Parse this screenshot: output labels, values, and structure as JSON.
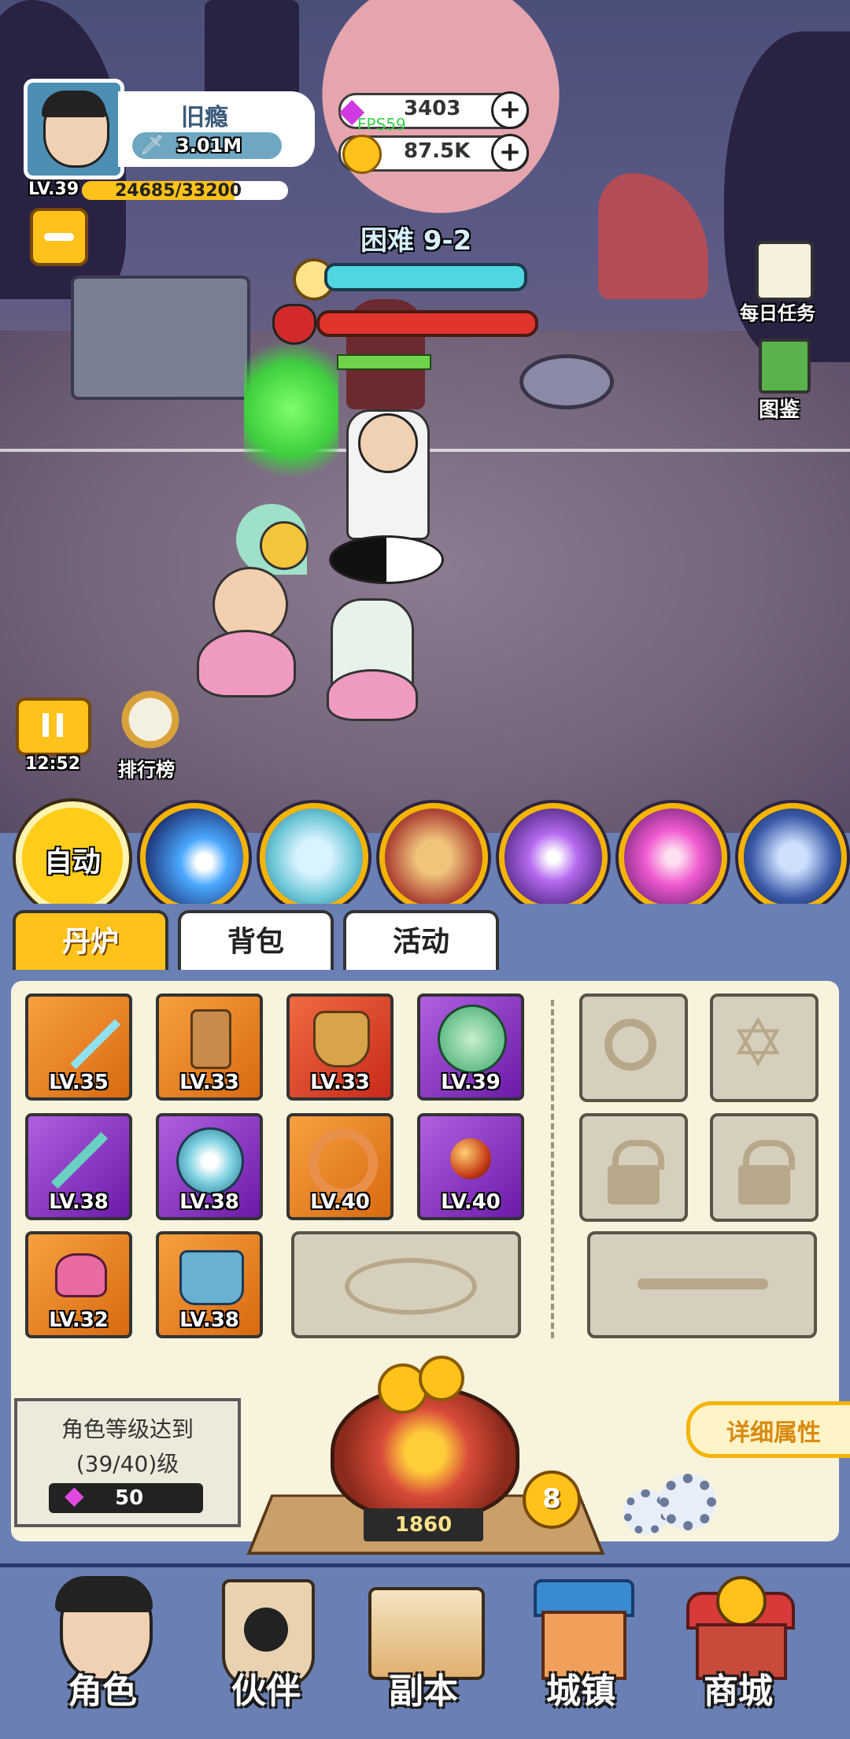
{
  "player": {
    "name": "旧瘾",
    "power": "3.01M",
    "level": "LV.39",
    "exp": "24685/33200"
  },
  "currency": {
    "gems": "3403",
    "coins": "87.5K",
    "fps": "FPS59"
  },
  "stage": {
    "label": "困难 9-2"
  },
  "side_menu": {
    "daily_tasks": "每日任务",
    "codex": "图鉴"
  },
  "battle_controls": {
    "timer": "12:52",
    "ranking": "排行榜"
  },
  "skills": {
    "auto": "自动",
    "list": [
      "comet-skill-icon",
      "ice-qilin-skill-icon",
      "beast-skill-icon",
      "purple-vortex-skill-icon",
      "pink-spiral-skill-icon",
      "thunder-card-skill-icon"
    ]
  },
  "tabs": [
    "丹炉",
    "背包",
    "活动"
  ],
  "equipment": [
    {
      "name": "sword-icon",
      "level": "LV.35",
      "rarity": "orange"
    },
    {
      "name": "scroll-icon",
      "level": "LV.33",
      "rarity": "orange"
    },
    {
      "name": "armor-icon",
      "level": "LV.33",
      "rarity": "red"
    },
    {
      "name": "dragon-orb-icon",
      "level": "LV.39",
      "rarity": "purple"
    },
    {
      "name": "jade-sword-icon",
      "level": "LV.38",
      "rarity": "purple"
    },
    {
      "name": "jade-disc-icon",
      "level": "LV.38",
      "rarity": "purple"
    },
    {
      "name": "bead-necklace-icon",
      "level": "LV.40",
      "rarity": "orange"
    },
    {
      "name": "fire-orb-icon",
      "level": "LV.40",
      "rarity": "purple"
    },
    {
      "name": "bracer-icon",
      "level": "LV.32",
      "rarity": "orange"
    },
    {
      "name": "boots-icon",
      "level": "LV.38",
      "rarity": "orange"
    }
  ],
  "requirement": {
    "line1": "角色等级达到",
    "line2": "(39/40)级",
    "gem_cost": "50"
  },
  "furnace": {
    "value": "1860",
    "badge": "8"
  },
  "detail_button": "详细属性",
  "bottom_nav": [
    "角色",
    "伙伴",
    "副本",
    "城镇",
    "商城"
  ],
  "colors": {
    "accent_gold": "#ffc21a",
    "panel_bg": "#f7f3dc",
    "nav_bg": "#6a7fb0",
    "hp_red": "#e0342c",
    "hp_cyan": "#4fd6e0"
  }
}
